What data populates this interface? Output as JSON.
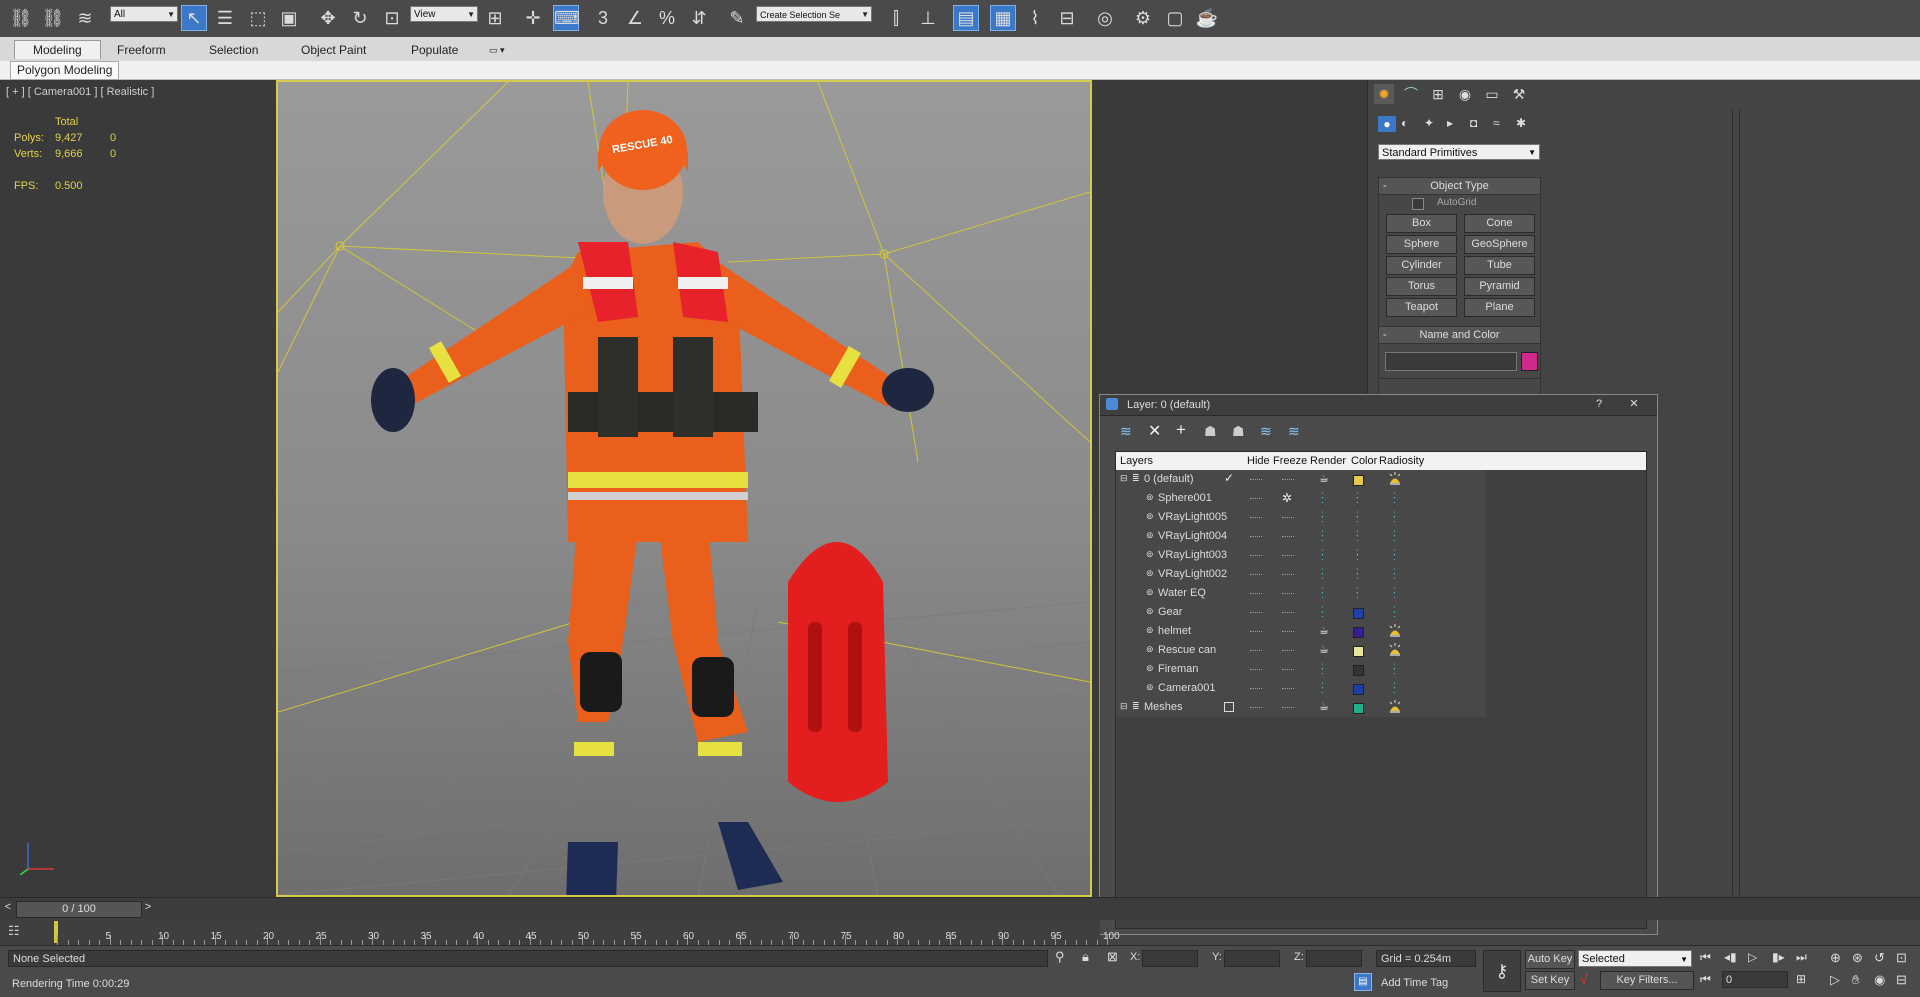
{
  "toolbar": {
    "selection_filter": "All",
    "reference_coord": "View",
    "named_selection_placeholder": "Create Selection Se"
  },
  "ribbon": {
    "tabs": [
      "Modeling",
      "Freeform",
      "Selection",
      "Object Paint",
      "Populate"
    ],
    "active_tab": "Modeling",
    "subpanel": "Polygon Modeling"
  },
  "viewport": {
    "label": "[ + ] [ Camera001 ] [ Realistic ]",
    "stats": {
      "header": "Total",
      "polys_label": "Polys:",
      "polys_total": "9,427",
      "polys_sel": "0",
      "verts_label": "Verts:",
      "verts_total": "9,666",
      "verts_sel": "0",
      "fps_label": "FPS:",
      "fps": "0.500"
    },
    "helmet_text": "RESCUE 40"
  },
  "command_panel": {
    "category": "Standard Primitives",
    "object_type_title": "Object Type",
    "autogrid": "AutoGrid",
    "buttons": [
      "Box",
      "Cone",
      "Sphere",
      "GeoSphere",
      "Cylinder",
      "Tube",
      "Torus",
      "Pyramid",
      "Teapot",
      "Plane"
    ],
    "name_color_title": "Name and Color",
    "color": "#d12a8c"
  },
  "layer_dialog": {
    "title": "Layer: 0 (default)",
    "help": "?",
    "close": "✕",
    "columns": [
      "Layers",
      "Hide",
      "Freeze",
      "Render",
      "Color",
      "Radiosity"
    ],
    "rows": [
      {
        "name": "0 (default)",
        "level": 0,
        "current": true,
        "freeze": "",
        "render": "teapot",
        "color": "#e8c84a",
        "radiosity": "bulb"
      },
      {
        "name": "Sphere001",
        "level": 1,
        "freeze": "snow",
        "render": "dots",
        "color": "dots",
        "radiosity": "dots"
      },
      {
        "name": "VRayLight005",
        "level": 1,
        "freeze": "",
        "render": "dots",
        "color": "dots",
        "radiosity": "dots"
      },
      {
        "name": "VRayLight004",
        "level": 1,
        "freeze": "",
        "render": "dots",
        "color": "dots",
        "radiosity": "dots"
      },
      {
        "name": "VRayLight003",
        "level": 1,
        "freeze": "",
        "render": "dots",
        "color": "dots",
        "radiosity": "dots"
      },
      {
        "name": "VRayLight002",
        "level": 1,
        "freeze": "",
        "render": "dots",
        "color": "dots",
        "radiosity": "dots"
      },
      {
        "name": "Water EQ",
        "level": 1,
        "freeze": "",
        "render": "dots",
        "color": "dots",
        "radiosity": "dots"
      },
      {
        "name": "Gear",
        "level": 1,
        "freeze": "",
        "render": "dots",
        "color": "#1e3ea8",
        "radiosity": "dots"
      },
      {
        "name": "helmet",
        "level": 1,
        "freeze": "",
        "render": "teapot",
        "color": "#3a1d8c",
        "radiosity": "bulb"
      },
      {
        "name": "Rescue can",
        "level": 1,
        "freeze": "",
        "render": "teapot",
        "color": "#e8e4a0",
        "radiosity": "bulb"
      },
      {
        "name": "Fireman",
        "level": 1,
        "freeze": "",
        "render": "dots",
        "color": "#333333",
        "radiosity": "dots"
      },
      {
        "name": "Camera001",
        "level": 1,
        "freeze": "",
        "render": "dots",
        "color": "#1e3ea8",
        "radiosity": "dots"
      },
      {
        "name": "Meshes",
        "level": 0,
        "current": false,
        "box": true,
        "freeze": "",
        "render": "teapot",
        "color": "#1fb08c",
        "radiosity": "bulb"
      }
    ]
  },
  "timeline": {
    "frame_display": "0 / 100",
    "prev": "<",
    "next": ">",
    "ticks": [
      "5",
      "10",
      "15",
      "20",
      "25",
      "30",
      "35",
      "40",
      "45",
      "50",
      "55",
      "60",
      "65",
      "70",
      "75",
      "80",
      "85",
      "90",
      "95",
      "100"
    ]
  },
  "status": {
    "selection": "None Selected",
    "render_time": "Rendering Time  0:00:29",
    "x_label": "X:",
    "y_label": "Y:",
    "z_label": "Z:",
    "grid": "Grid = 0.254m",
    "add_time_tag": "Add Time Tag",
    "auto_key": "Auto Key",
    "set_key": "Set Key",
    "key_mode": "Selected",
    "key_filters": "Key Filters...",
    "current_frame": "0"
  }
}
